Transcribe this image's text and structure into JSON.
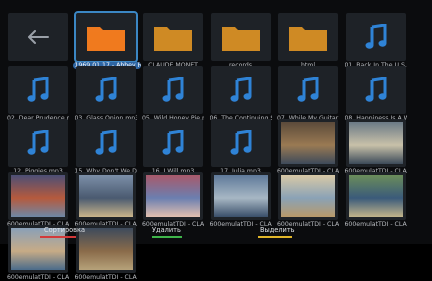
{
  "navigation": {
    "back_icon": "arrow-left-icon"
  },
  "items": [
    {
      "type": "back",
      "icon": "arrow-left-icon",
      "label": ""
    },
    {
      "type": "folder",
      "icon": "folder-icon",
      "label": "1969.01.17 - Abbey R",
      "color": "#f07a1f",
      "selected": true
    },
    {
      "type": "folder",
      "icon": "folder-icon",
      "label": "CLAUDE MONET",
      "color": "#cf8a24"
    },
    {
      "type": "folder",
      "icon": "folder-icon",
      "label": "records",
      "color": "#cf8a24"
    },
    {
      "type": "folder",
      "icon": "folder-icon",
      "label": "html",
      "color": "#cf8a24"
    },
    {
      "type": "audio",
      "icon": "music-note-icon",
      "label": "01. Back In The U.S.S"
    },
    {
      "type": "audio",
      "icon": "music-note-icon",
      "label": "02. Dear Prudence.mp3"
    },
    {
      "type": "audio",
      "icon": "music-note-icon",
      "label": "03. Glass Onion.mp3"
    },
    {
      "type": "audio",
      "icon": "music-note-icon",
      "label": "05. Wild Honey Pie.mp3"
    },
    {
      "type": "audio",
      "icon": "music-note-icon",
      "label": "06. The Continuing Sto"
    },
    {
      "type": "audio",
      "icon": "music-note-icon",
      "label": "07. While My Guitar G"
    },
    {
      "type": "audio",
      "icon": "music-note-icon",
      "label": "08. Happiness Is A W"
    },
    {
      "type": "audio",
      "icon": "music-note-icon",
      "label": "12. Piggies.mp3"
    },
    {
      "type": "audio",
      "icon": "music-note-icon",
      "label": "15. Why Don't We Do"
    },
    {
      "type": "audio",
      "icon": "music-note-icon",
      "label": "16. I Will.mp3"
    },
    {
      "type": "audio",
      "icon": "music-note-icon",
      "label": "17. Julia.mp3"
    },
    {
      "type": "image",
      "icon": "image-thumbnail",
      "label": "600emulatTDI - CLA",
      "palette": [
        "#5b4a3a",
        "#9a7a53",
        "#3e4a5a"
      ]
    },
    {
      "type": "image",
      "icon": "image-thumbnail",
      "label": "600emulatTDI - CLA",
      "palette": [
        "#6b7a86",
        "#c8c1a9",
        "#3c4a59"
      ]
    },
    {
      "type": "image",
      "icon": "image-thumbnail",
      "label": "600emulatTDI - CLA",
      "palette": [
        "#4c4f76",
        "#b55a3d",
        "#6e88a6"
      ]
    },
    {
      "type": "image",
      "icon": "image-thumbnail",
      "label": "600emulatTDI - CLA",
      "palette": [
        "#7c8fa8",
        "#4a5a70",
        "#c9b48a"
      ]
    },
    {
      "type": "image",
      "icon": "image-thumbnail",
      "label": "600emulatTDI - CLA",
      "palette": [
        "#a8596b",
        "#6b7fb0",
        "#e2c0b0"
      ]
    },
    {
      "type": "image",
      "icon": "image-thumbnail",
      "label": "600emulatTDI - CLA",
      "palette": [
        "#5f7a9a",
        "#a7b7c4",
        "#3a4f6a"
      ]
    },
    {
      "type": "image",
      "icon": "image-thumbnail",
      "label": "600emulatTDI - CLA",
      "palette": [
        "#d8c9a6",
        "#8aa2b6",
        "#b99a6a"
      ]
    },
    {
      "type": "image",
      "icon": "image-thumbnail",
      "label": "600emulatTDI - CLA",
      "palette": [
        "#6b8d5a",
        "#3a5a7a",
        "#c2b48a"
      ]
    },
    {
      "type": "image",
      "icon": "image-thumbnail",
      "label": "600emulatTDI - CLA",
      "palette": [
        "#8aa0b8",
        "#c7ab86",
        "#4a6b8a"
      ]
    },
    {
      "type": "image",
      "icon": "image-thumbnail",
      "label": "600emulatTDI - CLA",
      "palette": [
        "#3d4a5c",
        "#8a6b4a",
        "#b6a27a"
      ]
    }
  ],
  "footer": [
    {
      "label": "Сортировка",
      "color": "#d23a3a",
      "icon": "red-key"
    },
    {
      "label": "Удалить",
      "color": "#3fb54a",
      "icon": "green-key"
    },
    {
      "label": "Выделить",
      "color": "#e0b62a",
      "icon": "yellow-key"
    }
  ],
  "colors": {
    "background": "#0b0c0e",
    "tile": "#1e2227",
    "accent": "#3b87c4",
    "music": "#2f83d6"
  }
}
